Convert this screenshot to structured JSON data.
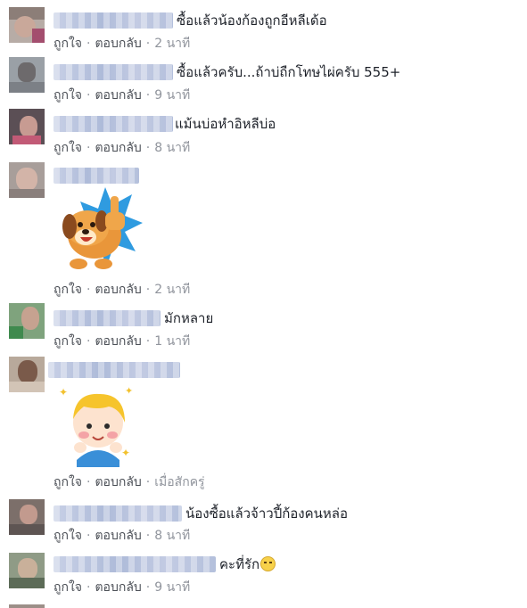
{
  "actions": {
    "like": "ถูกใจ",
    "reply": "ตอบกลับ",
    "separator": "·"
  },
  "comments": [
    {
      "text": "ซื้อแล้วน้องก้องถูกอีหลีเด้อ",
      "time": "2 นาที"
    },
    {
      "text": "ซื้อแล้วครับ...ถ้าบ่ถืกโทษไผ่ครับ 555+",
      "time": "9 นาที"
    },
    {
      "text": "แม้นบ่อหำอิหลีบ่อ",
      "time": "8 นาที"
    },
    {
      "text": "",
      "time": "2 นาที",
      "sticker": "dog-thumbs-up-sticker"
    },
    {
      "text": "มักหลาย",
      "time": "1 นาที"
    },
    {
      "text": "",
      "time": "เมื่อสักครู่",
      "sticker": "boy-blushing-sticker"
    },
    {
      "text": "น้องซื้อแล้วจ้าวปี้ก้องคนหล่อ",
      "time": "8 นาที"
    },
    {
      "text": "คะที่รัก",
      "time": "9 นาที",
      "emoji": "smiling-face-emoji"
    }
  ],
  "colors": {
    "action_text": "#90949c",
    "link_text": "#4b4f56",
    "comment_text": "#1d2129",
    "blurred_name": "#b7c2de"
  }
}
